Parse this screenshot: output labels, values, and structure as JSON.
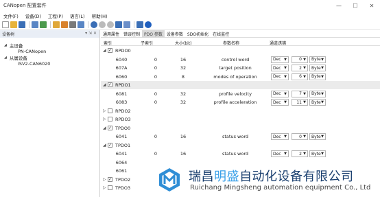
{
  "window": {
    "title": "CANopen 配置套件",
    "controls": [
      "—",
      "☐",
      "✕"
    ]
  },
  "menu": [
    "文件(F)",
    "设备(D)",
    "工程(P)",
    "语言(L)",
    "帮助(H)"
  ],
  "left_panel": {
    "title": "设备树",
    "pin_glyphs": "▾ ⇲ ✕",
    "tree": [
      {
        "label": "主设备",
        "level": 0,
        "expanded": true
      },
      {
        "label": "PN-CANopen",
        "level": 1
      },
      {
        "label": "从属设备",
        "level": 0,
        "expanded": true
      },
      {
        "label": "ISV2-CAN6020",
        "level": 1
      }
    ]
  },
  "tabs": [
    "通用属性",
    "错误控制",
    "PDO 参数",
    "设备参数",
    "SDO初始化",
    "在线监控"
  ],
  "active_tab": 2,
  "columns": [
    "索引",
    "子索引",
    "大小(bit)",
    "参数名称",
    "通道诱捕"
  ],
  "rows": [
    {
      "type": "pdo",
      "name": "RPDO0",
      "expanded": true,
      "checked": true
    },
    {
      "type": "entry",
      "index": "6040",
      "sub": "0",
      "size": "16",
      "param": "control word",
      "fmt": "Dec",
      "value": "0",
      "unit": "Byte"
    },
    {
      "type": "entry",
      "index": "607A",
      "sub": "0",
      "size": "32",
      "param": "target position",
      "fmt": "Dec",
      "value": "2",
      "unit": "Byte"
    },
    {
      "type": "entry",
      "index": "6060",
      "sub": "0",
      "size": "8",
      "param": "modes of operation",
      "fmt": "Dec",
      "value": "6",
      "unit": "Byte"
    },
    {
      "type": "pdo",
      "name": "RPDO1",
      "expanded": true,
      "checked": true,
      "selected": true
    },
    {
      "type": "entry",
      "index": "6081",
      "sub": "0",
      "size": "32",
      "param": "profile velocity",
      "fmt": "Dec",
      "value": "7",
      "unit": "Byte"
    },
    {
      "type": "entry",
      "index": "6083",
      "sub": "0",
      "size": "32",
      "param": "profile acceleration",
      "fmt": "Dec",
      "value": "11",
      "unit": "Byte"
    },
    {
      "type": "pdo",
      "name": "RPDO2",
      "expanded": false,
      "checked": false
    },
    {
      "type": "pdo",
      "name": "RPDO3",
      "expanded": false,
      "checked": false
    },
    {
      "type": "pdo",
      "name": "TPDO0",
      "expanded": true,
      "checked": true
    },
    {
      "type": "entry",
      "index": "6041",
      "sub": "0",
      "size": "16",
      "param": "status word",
      "fmt": "Dec",
      "value": "0",
      "unit": "Byte"
    },
    {
      "type": "pdo",
      "name": "TPDO1",
      "expanded": true,
      "checked": true
    },
    {
      "type": "entry",
      "index": "6041",
      "sub": "0",
      "size": "16",
      "param": "status word",
      "fmt": "Dec",
      "value": "2",
      "unit": "Byte"
    },
    {
      "type": "entry",
      "index": "6064",
      "sub": "",
      "size": "",
      "param": "",
      "fmt": "",
      "value": "",
      "unit": ""
    },
    {
      "type": "entry",
      "index": "6061",
      "sub": "",
      "size": "",
      "param": "",
      "fmt": "",
      "value": "",
      "unit": ""
    },
    {
      "type": "pdo",
      "name": "TPDO2",
      "expanded": false,
      "checked": true
    },
    {
      "type": "pdo",
      "name": "TPDO3",
      "expanded": false,
      "checked": false
    }
  ],
  "watermark": {
    "cn_a": "瑞昌",
    "cn_hl": "明盛",
    "cn_b": "自动化设备有限公司",
    "en": "Ruichang Mingsheng automation equipment Co., Ltd"
  },
  "colors": {
    "accent": "#3aa0e8",
    "brand_dark": "#1a3f6f"
  }
}
